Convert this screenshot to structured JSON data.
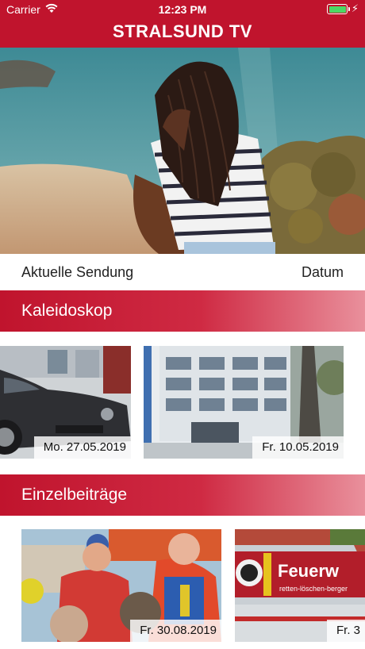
{
  "status_bar": {
    "carrier": "Carrier",
    "time": "12:23 PM"
  },
  "nav": {
    "title": "STRALSUND TV"
  },
  "current": {
    "label": "Aktuelle Sendung",
    "date_label": "Datum"
  },
  "sections": [
    {
      "title": "Kaleidoskop",
      "items": [
        {
          "date": "Mo. 27.05.2019"
        },
        {
          "date": "Fr. 10.05.2019"
        }
      ]
    },
    {
      "title": "Einzelbeiträge",
      "items": [
        {
          "date": "Fr. 30.08.2019"
        },
        {
          "date": "Fr. 3",
          "banner_text": "Feuerw",
          "banner_sub": "retten-löschen-berger"
        }
      ]
    }
  ],
  "colors": {
    "brand": "#c0142d",
    "battery": "#4cd964"
  }
}
